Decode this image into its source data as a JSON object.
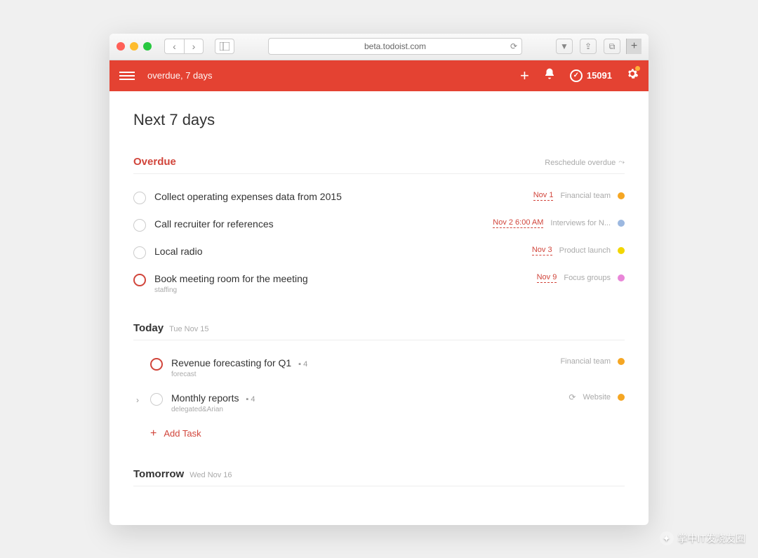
{
  "browser": {
    "url": "beta.todoist.com"
  },
  "topbar": {
    "breadcrumb": "overdue, 7 days",
    "karma": "15091"
  },
  "page": {
    "title": "Next 7 days"
  },
  "overdue": {
    "title": "Overdue",
    "action": "Reschedule overdue",
    "tasks": [
      {
        "title": "Collect operating expenses data from 2015",
        "sub": "",
        "due": "Nov 1",
        "project": "Financial team",
        "color": "#f5a623",
        "priority": "normal"
      },
      {
        "title": "Call recruiter for references",
        "sub": "",
        "due": "Nov 2 6:00 AM",
        "project": "Interviews for N...",
        "color": "#9cb8e0",
        "priority": "normal"
      },
      {
        "title": "Local radio",
        "sub": "",
        "due": "Nov 3",
        "project": "Product launch",
        "color": "#f2d600",
        "priority": "normal"
      },
      {
        "title": "Book meeting room for the meeting",
        "sub": "staffing",
        "due": "Nov 9",
        "project": "Focus groups",
        "color": "#e986d8",
        "priority": "p1"
      }
    ]
  },
  "today": {
    "title": "Today",
    "date": "Tue Nov 15",
    "add_label": "Add Task",
    "tasks": [
      {
        "title": "Revenue forecasting for Q1",
        "sub": "forecast",
        "comments": "4",
        "project": "Financial team",
        "color": "#f5a623",
        "priority": "p1",
        "expandable": false,
        "recurring": false
      },
      {
        "title": "Monthly reports",
        "sub": "delegated&Arian",
        "comments": "4",
        "project": "Website",
        "color": "#f5a623",
        "priority": "normal",
        "expandable": true,
        "recurring": true
      }
    ]
  },
  "tomorrow": {
    "title": "Tomorrow",
    "date": "Wed Nov 16"
  },
  "watermark": "掌中IT发烧友圈"
}
